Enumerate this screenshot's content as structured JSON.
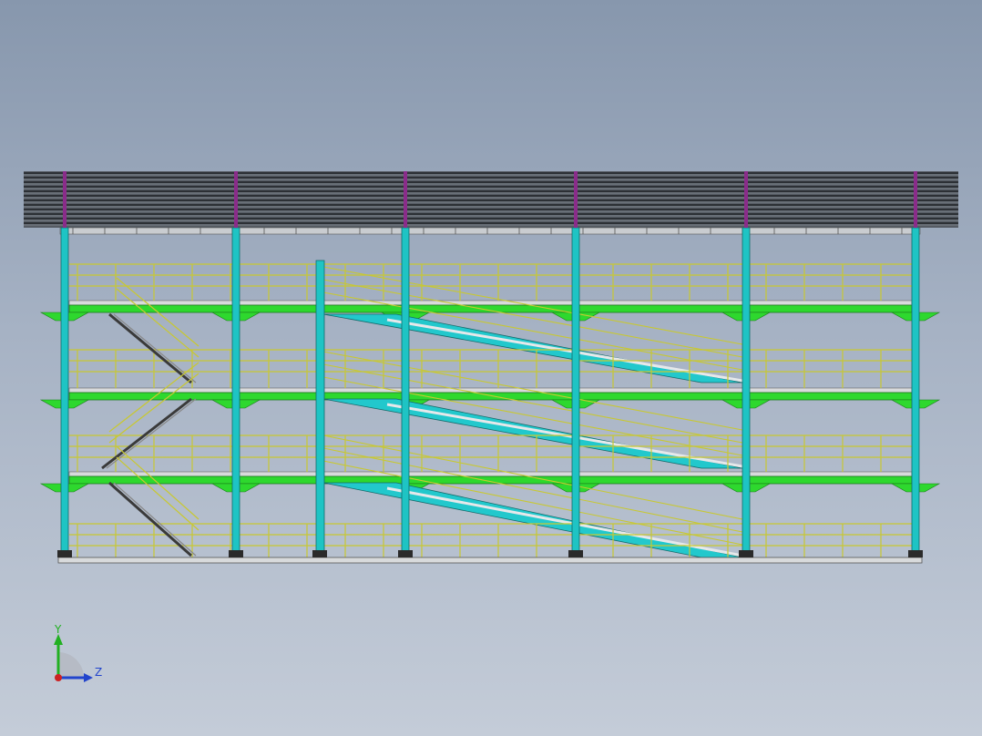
{
  "viewport": {
    "background_top": "#8797ad",
    "background_bottom": "#c4ccd8"
  },
  "colors": {
    "roof_panel": "#555b63",
    "roof_line": "#1e2226",
    "column": "#1ec4c4",
    "column_cap": "#8a2c8a",
    "floor_beam": "#2ed82e",
    "ramp": "#22c8cc",
    "railing": "#c8c832",
    "stair": "#3a3a3a",
    "base_plate": "#2a2a2a",
    "slab": "#d8dadc"
  },
  "triad": {
    "y_label": "Y",
    "z_label": "Z",
    "y_color": "#22b022",
    "z_color": "#2244cc",
    "origin_color": "#cc2222",
    "icon": "coordinate-triad-icon"
  }
}
